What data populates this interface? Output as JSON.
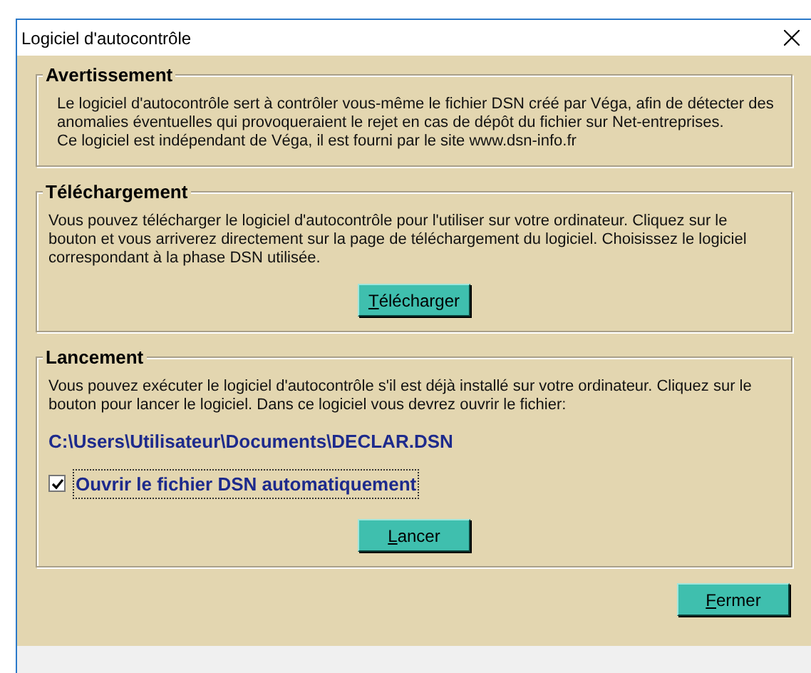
{
  "window": {
    "title": "Logiciel d'autocontrôle"
  },
  "sections": [
    {
      "title": "Avertissement",
      "text": [
        "Le logiciel d'autocontrôle sert à contrôler vous-même le fichier DSN créé par Véga, afin de détecter des anomalies éventuelles qui provoqueraient le rejet en cas de dépôt du fichier sur Net-entreprises.",
        "Ce logiciel est indépendant de Véga, il est fourni par le site www.dsn-info.fr"
      ]
    },
    {
      "title": "Téléchargement",
      "text": [
        "Vous pouvez télécharger le logiciel d'autocontrôle pour l'utiliser sur votre ordinateur. Cliquez sur le bouton et vous arriverez directement sur la page de téléchargement du logiciel. Choisissez le logiciel correspondant à la phase DSN utilisée."
      ],
      "button": "Télécharger"
    },
    {
      "title": "Lancement",
      "text": [
        "Vous pouvez exécuter le logiciel d'autocontrôle s'il est déjà installé sur votre ordinateur. Cliquez sur le bouton pour lancer le logiciel. Dans ce logiciel vous devrez ouvrir le fichier:"
      ],
      "path": "C:\\Users\\Utilisateur\\Documents\\DECLAR.DSN",
      "checkbox": {
        "label": "Ouvrir le fichier DSN automatiquement",
        "checked": true
      },
      "button": "Lancer"
    }
  ],
  "close_button": "Fermer"
}
